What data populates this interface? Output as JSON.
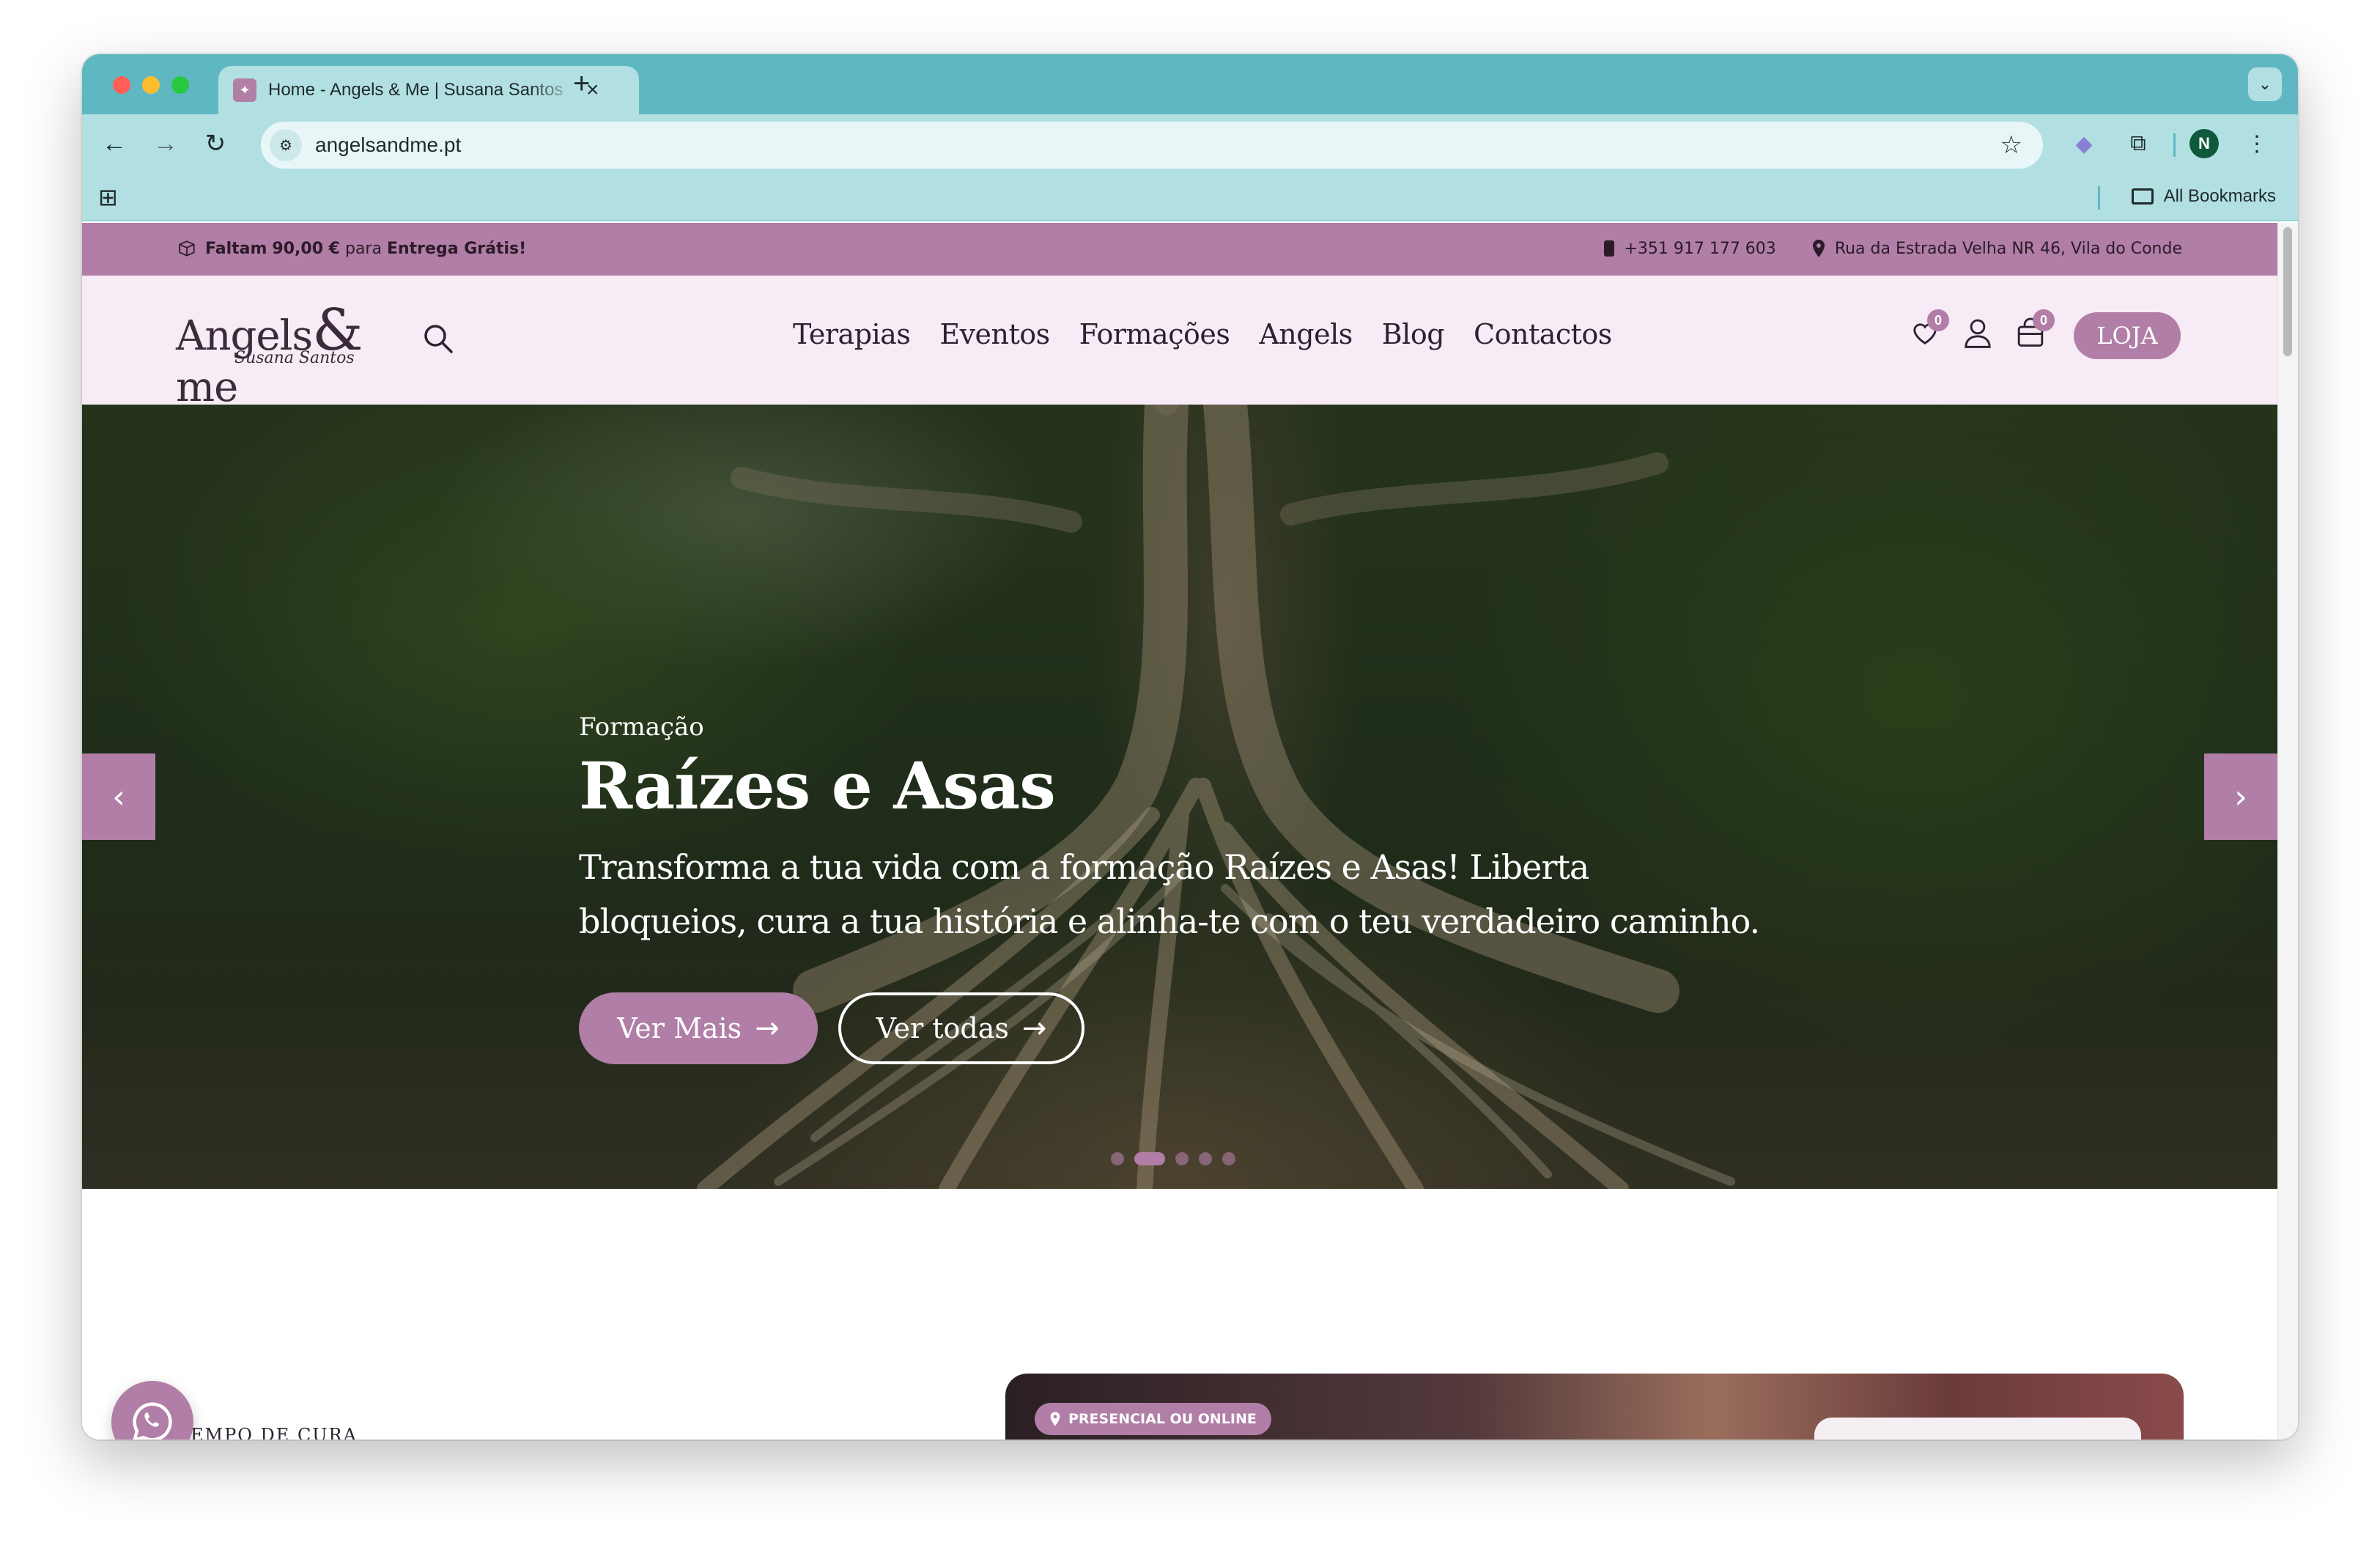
{
  "browser": {
    "tab_title": "Home - Angels & Me | Susana Santos",
    "url": "angelsandme.pt",
    "bookmarks_label": "All Bookmarks",
    "profile_initial": "N"
  },
  "topbar": {
    "shipping_prefix": "Faltam",
    "shipping_amount": "90,00 €",
    "shipping_mid": "para",
    "shipping_bold": "Entrega Grátis!",
    "phone": "+351 917 177 603",
    "address": "Rua da Estrada Velha NR 46, Vila do Conde"
  },
  "header": {
    "logo_main": "Angels",
    "logo_amp": "&",
    "logo_me": "me",
    "logo_sub": "Susana Santos",
    "nav": [
      "Terapias",
      "Eventos",
      "Formações",
      "Angels",
      "Blog",
      "Contactos"
    ],
    "wishlist_count": "0",
    "cart_count": "0",
    "shop_label": "LOJA"
  },
  "hero": {
    "kicker": "Formação",
    "title": "Raízes e Asas",
    "description": "Transforma a tua vida com a formação Raízes e Asas! Liberta bloqueios, cura a tua história e alinha-te com o teu verdadeiro caminho.",
    "primary_label": "Ver Mais",
    "secondary_label": "Ver todas",
    "slides_count": 5,
    "active_slide": 2
  },
  "section": {
    "label": "TEMPO DE CURA",
    "card_tag": "PRESENCIAL OU ONLINE"
  },
  "colors": {
    "brand": "#b07ea6",
    "header_bg": "#f7ebf5",
    "chrome": "#5fb8c1"
  }
}
